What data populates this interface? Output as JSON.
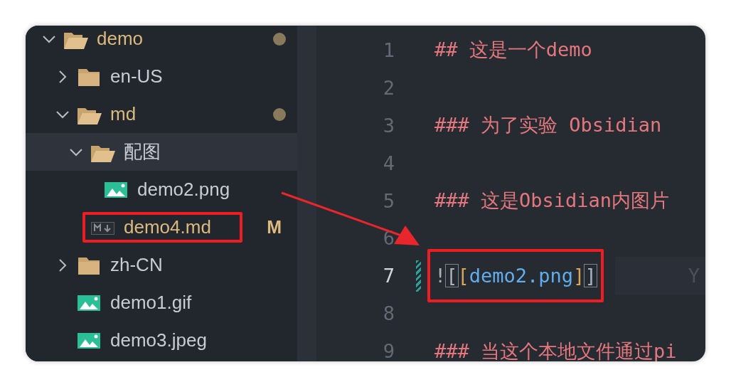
{
  "explorer": {
    "items": [
      {
        "kind": "folder",
        "name": "demo",
        "expanded": true,
        "modified": true,
        "dot": true,
        "selected": false,
        "children": [
          {
            "kind": "folder",
            "name": "en-US",
            "expanded": false,
            "modified": false,
            "dot": false,
            "selected": false
          },
          {
            "kind": "folder",
            "name": "md",
            "expanded": true,
            "modified": true,
            "dot": true,
            "selected": false,
            "children": [
              {
                "kind": "folder",
                "name": "配图",
                "expanded": true,
                "modified": false,
                "dot": false,
                "selected": true,
                "children": [
                  {
                    "kind": "image",
                    "name": "demo2.png",
                    "modified": false,
                    "selected": false,
                    "highlighted": false
                  }
                ]
              },
              {
                "kind": "markdown",
                "name": "demo4.md",
                "modified": true,
                "badge": "M",
                "selected": false,
                "highlighted": true
              }
            ]
          },
          {
            "kind": "folder",
            "name": "zh-CN",
            "expanded": false,
            "modified": false,
            "dot": false,
            "selected": false
          },
          {
            "kind": "image",
            "name": "demo1.gif",
            "modified": false,
            "selected": false,
            "highlighted": false
          },
          {
            "kind": "image",
            "name": "demo3.jpeg",
            "modified": false,
            "selected": false,
            "highlighted": false
          }
        ]
      }
    ]
  },
  "editor": {
    "lines": [
      {
        "number": "1",
        "segments": [
          {
            "kind": "heading",
            "text": "## 这是一个demo"
          }
        ]
      },
      {
        "number": "2"
      },
      {
        "number": "3",
        "segments": [
          {
            "kind": "heading",
            "text": "### 为了实验 Obsidian"
          }
        ]
      },
      {
        "number": "4"
      },
      {
        "number": "5",
        "segments": [
          {
            "kind": "heading",
            "text": "### 这是Obsidian内图片"
          }
        ]
      },
      {
        "number": "6"
      },
      {
        "number": "7",
        "current": true,
        "changed": true,
        "highlighted": true,
        "segments": [
          {
            "kind": "punct",
            "text": "!"
          },
          {
            "kind": "match",
            "text": "["
          },
          {
            "kind": "bracket",
            "text": "["
          },
          {
            "kind": "link",
            "text": "demo2.png"
          },
          {
            "kind": "bracket",
            "text": "]"
          },
          {
            "kind": "match",
            "text": "]"
          }
        ],
        "blame": "Y"
      },
      {
        "number": "8"
      },
      {
        "number": "9",
        "segments": [
          {
            "kind": "heading",
            "text": "### 当这个本地文件通过pi"
          }
        ]
      }
    ]
  },
  "arrow": true
}
